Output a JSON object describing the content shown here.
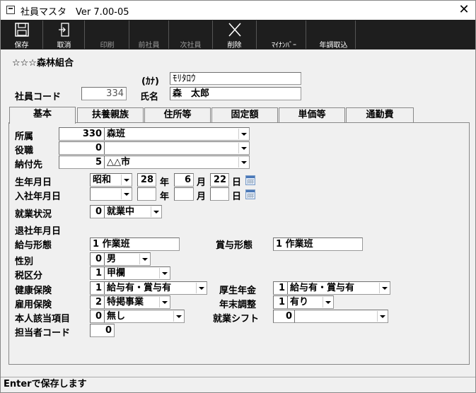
{
  "window": {
    "title": "社員マスタ　Ver 7.00-05",
    "close_glyph": "✕"
  },
  "toolbar": {
    "save": "保存",
    "cancel": "取消",
    "print": "印刷",
    "prev": "前社員",
    "next": "次社員",
    "delete": "削除",
    "mynumber": "ﾏｲﾅﾝﾊﾞｰ",
    "year_end": "年調取込"
  },
  "header": {
    "org": "☆☆☆森林組合",
    "kana_label": "(ｶﾅ)",
    "kana_value": "ﾓﾘﾀﾛｳ",
    "code_label": "社員コード",
    "code_value": "334",
    "name_label": "氏名",
    "name_value": "森　太郎"
  },
  "tabs": [
    "基本",
    "扶養親族",
    "住所等",
    "固定額",
    "単価等",
    "通勤費"
  ],
  "form": {
    "shozoku_label": "所属",
    "shozoku_code": "330",
    "shozoku_value": "森班",
    "yakushoku_label": "役職",
    "yakushoku_code": "0",
    "yakushoku_value": "",
    "noufu_label": "納付先",
    "noufu_code": "5",
    "noufu_value": "△△市",
    "birth_label": "生年月日",
    "birth_era": "昭和",
    "birth_year": "28",
    "birth_month": "6",
    "birth_day": "22",
    "nen": "年",
    "tsuki": "月",
    "hi": "日",
    "join_label": "入社年月日",
    "join_era": "",
    "join_year": "",
    "join_month": "",
    "join_day": "",
    "shugyo_label": "就業状況",
    "shugyo_code": "0",
    "shugyo_value": "就業中",
    "taisha_label": "退社年月日",
    "kyuyo_keitai_label": "給与形態",
    "kyuyo_keitai_value": "1 作業班",
    "shoyo_keitai_label": "賞与形態",
    "shoyo_keitai_value": "1 作業班",
    "seibetsu_label": "性別",
    "seibetsu_code": "0",
    "seibetsu_value": "男",
    "zeiku_label": "税区分",
    "zeiku_code": "1",
    "zeiku_value": "甲欄",
    "kenko_label": "健康保険",
    "kenko_code": "1",
    "kenko_value": "給与有・賞与有",
    "kosei_label": "厚生年金",
    "kosei_code": "1",
    "kosei_value": "給与有・賞与有",
    "koyo_label": "雇用保険",
    "koyo_code": "2",
    "koyo_value": "特掲事業",
    "nenmatsu_label": "年末調整",
    "nenmatsu_code": "1",
    "nenmatsu_value": "有り",
    "honnin_label": "本人該当項目",
    "honnin_code": "0",
    "honnin_value": "無し",
    "shift_label": "就業シフト",
    "shift_code": "0",
    "shift_value": "",
    "tanto_label": "担当者コード",
    "tanto_code": "0"
  },
  "status": "Enterで保存します"
}
